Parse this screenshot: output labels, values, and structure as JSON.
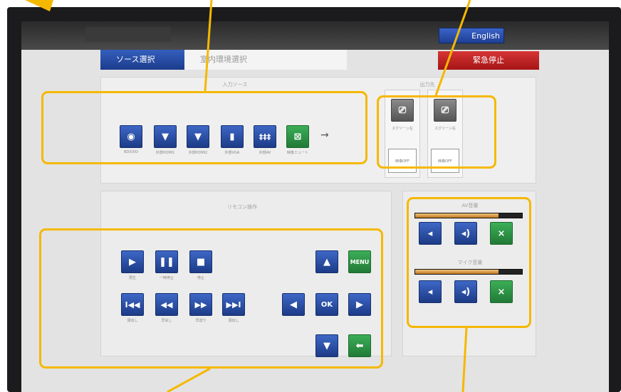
{
  "topbar": {
    "language_label": "English"
  },
  "tabs": [
    {
      "label": "ソース選択",
      "active": true
    },
    {
      "label": "室内環境選択",
      "active": false
    }
  ],
  "emergency_stop_label": "緊急停止",
  "source_section": {
    "title": "入力ソース",
    "items": [
      {
        "icon": "disc-icon",
        "color": "blue",
        "label": "BD/DVD"
      },
      {
        "icon": "pen-icon",
        "color": "blue",
        "label": "外部HDMI1"
      },
      {
        "icon": "pen-icon",
        "color": "blue",
        "label": "外部HDMI2"
      },
      {
        "icon": "camera-icon",
        "color": "blue",
        "label": "外部VGA"
      },
      {
        "icon": "equalizer-icon",
        "color": "blue",
        "label": "外部AV"
      },
      {
        "icon": "no-signal-icon",
        "color": "green",
        "label": "映像ミュート"
      }
    ]
  },
  "output_section": {
    "title": "出力先",
    "columns": [
      {
        "label": "スクリーン左",
        "sub_label": "映像OFF"
      },
      {
        "label": "スクリーン右",
        "sub_label": "映像OFF"
      }
    ]
  },
  "remote_section": {
    "title": "リモコン操作",
    "playback_row": [
      "再生",
      "一時停止",
      "停止"
    ],
    "skip_row": [
      "頭出し",
      "早戻し",
      "早送り",
      "頭出し"
    ],
    "ok_label": "OK",
    "menu_label": "MENU"
  },
  "volume_section": {
    "av_title": "AV音量",
    "mic_title": "マイク音量",
    "av_level": 0.78,
    "mic_level": 0.78
  },
  "colors": {
    "accent_blue": "#1f3f95",
    "accent_green": "#217a37",
    "estop_red": "#c11e1e",
    "annotation_yellow": "#f5b800"
  }
}
